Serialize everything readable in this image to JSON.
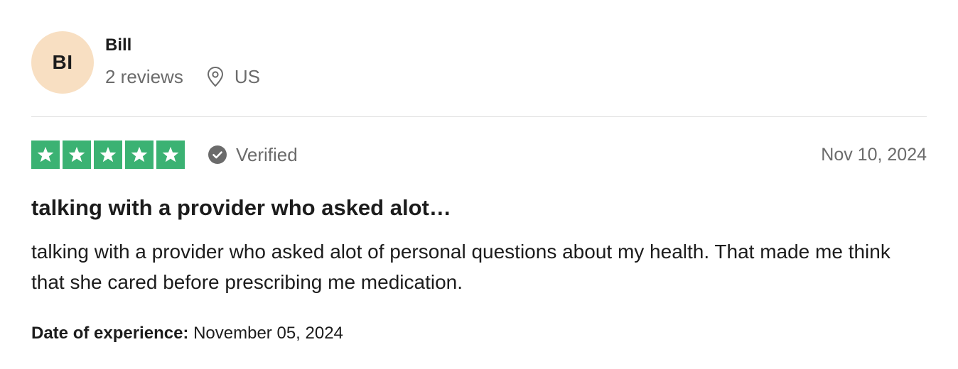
{
  "reviewer": {
    "initials": "BI",
    "name": "Bill",
    "reviews_count": "2 reviews",
    "country": "US",
    "location_icon": "map-pin-icon",
    "avatar_color": "#f8dfc2"
  },
  "rating": {
    "stars": 5,
    "max_stars": 5,
    "star_color": "#3bb273",
    "verified_label": "Verified",
    "verified_icon": "check-circle-icon",
    "date": "Nov 10, 2024"
  },
  "review": {
    "title": "talking with a provider who asked alot…",
    "body": "talking with a provider who asked alot of personal questions about my health. That made me think that she cared before prescribing me medication."
  },
  "experience": {
    "label": "Date of experience:",
    "date": "November 05, 2024"
  }
}
